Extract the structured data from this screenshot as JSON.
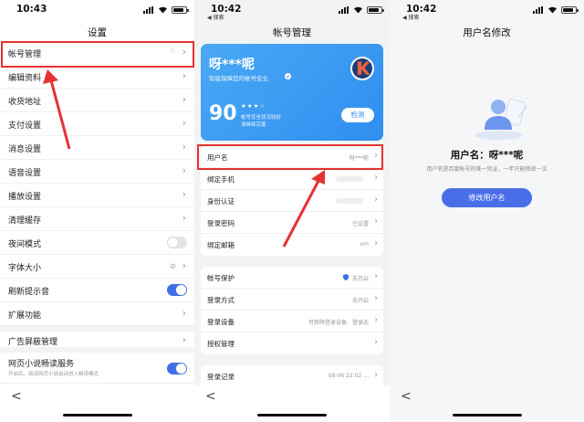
{
  "screen1": {
    "time": "10:43",
    "title": "设置",
    "items": [
      {
        "label": "帐号管理",
        "kind": "chevron"
      },
      {
        "label": "编辑资料",
        "kind": "chevron"
      },
      {
        "label": "收货地址",
        "kind": "chevron"
      },
      {
        "label": "支付设置",
        "kind": "chevron"
      },
      {
        "label": "消息设置",
        "kind": "chevron"
      },
      {
        "label": "语音设置",
        "kind": "chevron"
      },
      {
        "label": "播放设置",
        "kind": "chevron"
      },
      {
        "label": "清理缓存",
        "kind": "chevron"
      },
      {
        "label": "夜间模式",
        "kind": "toggle-off"
      },
      {
        "label": "字体大小",
        "kind": "value",
        "value": "中"
      },
      {
        "label": "刷新提示音",
        "kind": "toggle-on"
      },
      {
        "label": "扩展功能",
        "kind": "chevron"
      },
      {
        "label": "广告屏蔽管理",
        "kind": "chevron"
      }
    ],
    "reader_title": "网页小说畅读服务",
    "reader_desc": "开启后，阅读网页小说自动进入畅读模式",
    "back_icon": "chevron-left-icon"
  },
  "screen2": {
    "time": "10:42",
    "back_label": "◀ 搜索",
    "title": "帐号管理",
    "card": {
      "name": "呀***呢",
      "subtitle": "智能保障您的帐号安全",
      "score": "90",
      "stars": "★★★☆",
      "desc1": "帐号安全状况较好",
      "desc2": "请继续完善",
      "check_label": "检测"
    },
    "group1": [
      {
        "label": "用户名",
        "value": "呀***呢"
      },
      {
        "label": "绑定手机",
        "value": ""
      },
      {
        "label": "身份认证",
        "value": ""
      },
      {
        "label": "登录密码",
        "value": "已设置"
      },
      {
        "label": "绑定邮箱",
        "value": "om"
      }
    ],
    "group2": [
      {
        "label": "帐号保护",
        "value": "去开启"
      },
      {
        "label": "登录方式",
        "value": "去开启"
      },
      {
        "label": "登录设备",
        "value": "可移除登录设备、登录态"
      },
      {
        "label": "授权管理",
        "value": ""
      }
    ],
    "group3": [
      {
        "label": "登录记录",
        "value": "08-06 22:02 ..."
      }
    ]
  },
  "screen3": {
    "time": "10:42",
    "back_label": "◀ 搜索",
    "title": "用户名修改",
    "username_line": "用户名：呀***呢",
    "hint": "用户名是百度帐号的唯一凭证，一年只能修改一次",
    "button_label": "修改用户名"
  },
  "colors": {
    "highlight": "#e53232",
    "accent": "#3e6ee8",
    "card_blue": "#2f8ef0"
  }
}
